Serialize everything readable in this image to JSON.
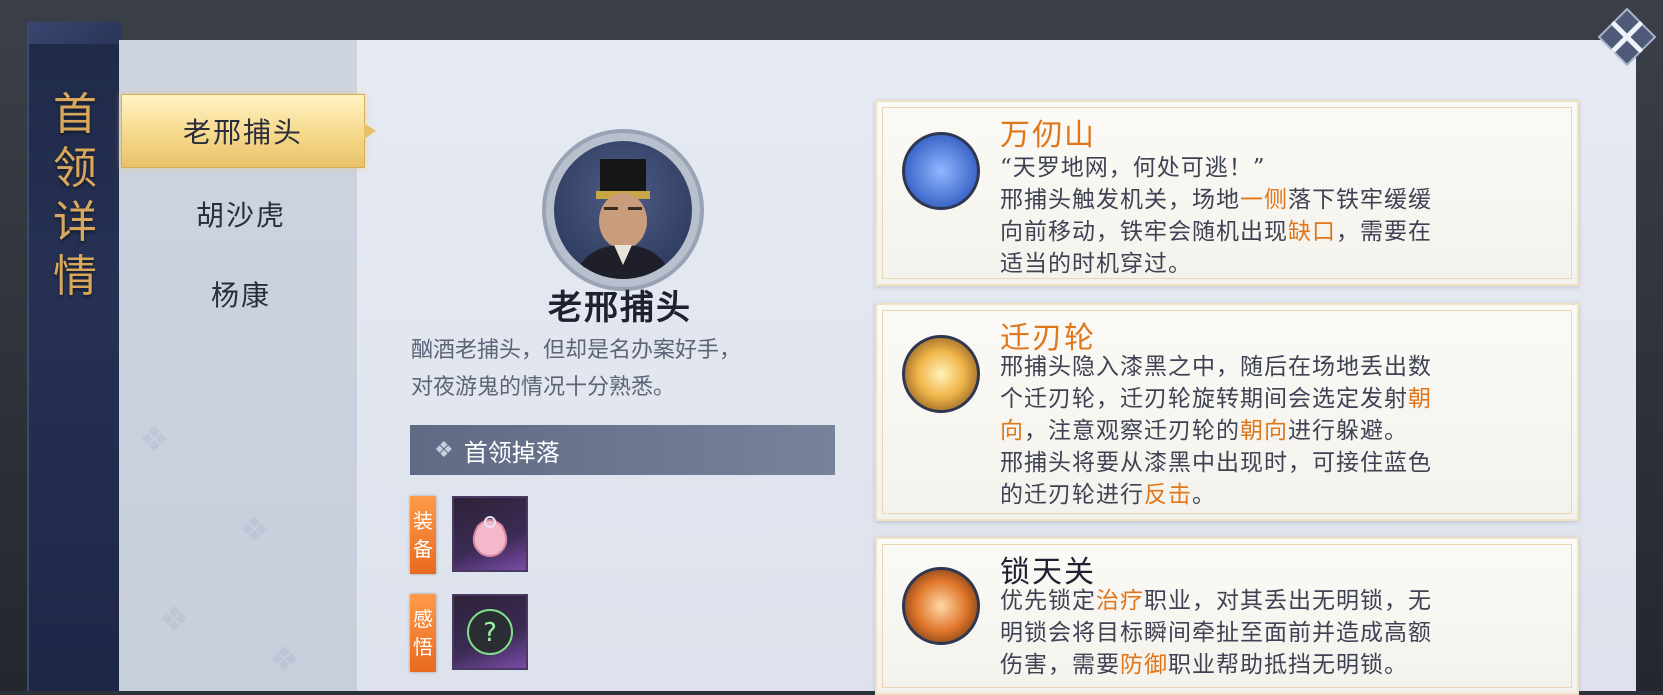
{
  "panel_title": [
    "首",
    "领",
    "详",
    "情"
  ],
  "boss_tabs": [
    {
      "label": "老邢捕头",
      "active": true
    },
    {
      "label": "胡沙虎",
      "active": false
    },
    {
      "label": "杨康",
      "active": false
    }
  ],
  "boss": {
    "name": "老邢捕头",
    "description_lines": [
      "酗酒老捕头，但却是名办案好手，",
      "对夜游鬼的情况十分熟悉。"
    ]
  },
  "drops": {
    "header": "首领掉落",
    "items": [
      {
        "tag": [
          "装",
          "备"
        ],
        "icon": "pouch-icon"
      },
      {
        "tag": [
          "感",
          "悟"
        ],
        "icon": "question-orb-icon"
      }
    ]
  },
  "skills": [
    {
      "title": "万仞山",
      "title_color": "#e0761a",
      "icon": "blue-figure-skill-icon",
      "body": [
        [
          {
            "t": "“天罗地网，何处可逃！”"
          }
        ],
        [
          {
            "t": "邢捕头触发机关，场地"
          },
          {
            "t": "一侧",
            "hl": true
          },
          {
            "t": "落下铁牢缓缓"
          }
        ],
        [
          {
            "t": "向前移动，铁牢会随机出现"
          },
          {
            "t": "缺口",
            "hl": true
          },
          {
            "t": "，需要在"
          }
        ],
        [
          {
            "t": "适当的时机穿过。"
          }
        ]
      ]
    },
    {
      "title": "迁刃轮",
      "title_color": "#e0761a",
      "icon": "golden-wheel-skill-icon",
      "body": [
        [
          {
            "t": "邢捕头隐入漆黑之中，随后在场地丢出数"
          }
        ],
        [
          {
            "t": "个迁刃轮，迁刃轮旋转期间会选定发射"
          },
          {
            "t": "朝",
            "hl": true
          }
        ],
        [
          {
            "t": "向",
            "hl": true
          },
          {
            "t": "，注意观察迁刃轮的"
          },
          {
            "t": "朝向",
            "hl": true
          },
          {
            "t": "进行躲避。"
          }
        ],
        [
          {
            "t": "邢捕头将要从漆黑中出现时，可接住蓝色"
          }
        ],
        [
          {
            "t": "的迁刃轮进行"
          },
          {
            "t": "反击",
            "hl": true
          },
          {
            "t": "。"
          }
        ]
      ]
    },
    {
      "title": "锁天关",
      "title_color": "#1d2130",
      "icon": "flame-lock-skill-icon",
      "body": [
        [
          {
            "t": "优先锁定"
          },
          {
            "t": "治疗",
            "hl": true
          },
          {
            "t": "职业，对其丢出无明锁，无"
          }
        ],
        [
          {
            "t": "明锁会将目标瞬间牵扯至面前并造成高额"
          }
        ],
        [
          {
            "t": "伤害，需要"
          },
          {
            "t": "防御",
            "hl": true
          },
          {
            "t": "职业帮助抵挡无明锁。"
          }
        ]
      ]
    }
  ],
  "colors": {
    "highlight": "#e0761a",
    "gold_title": "#d9a85a",
    "tag_orange": "#e86a1f"
  }
}
